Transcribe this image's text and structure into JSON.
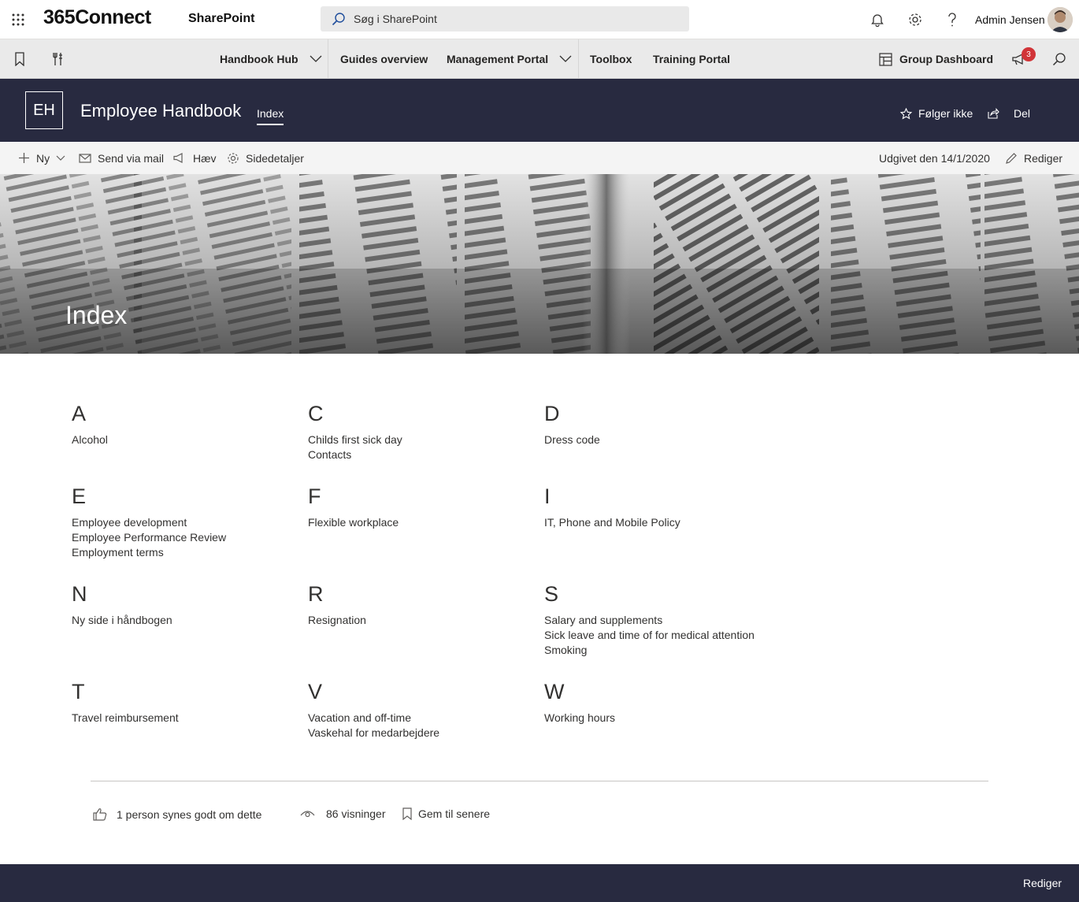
{
  "suitebar": {
    "brand": "365Connect",
    "app_name": "SharePoint",
    "search_placeholder": "Søg i SharePoint",
    "user_name": "Admin Jensen"
  },
  "hubnav": {
    "items": [
      {
        "label": "Handbook Hub",
        "has_dropdown": true
      },
      {
        "label": "Guides overview",
        "has_dropdown": false
      },
      {
        "label": "Management Portal",
        "has_dropdown": true
      },
      {
        "label": "Toolbox",
        "has_dropdown": false
      },
      {
        "label": "Training Portal",
        "has_dropdown": false
      }
    ],
    "group_dashboard": "Group Dashboard",
    "notification_count": "3"
  },
  "site": {
    "logo_text": "EH",
    "title": "Employee Handbook",
    "nav_item": "Index",
    "follow_label": "Følger ikke",
    "share_label": "Del"
  },
  "commandbar": {
    "new_label": "Ny",
    "send_label": "Send via mail",
    "promote_label": "Hæv",
    "details_label": "Sidedetaljer",
    "published": "Udgivet den 14/1/2020",
    "edit_label": "Rediger"
  },
  "banner": {
    "title": "Index"
  },
  "index": [
    {
      "letter": "A",
      "entries": [
        "Alcohol"
      ]
    },
    {
      "letter": "C",
      "entries": [
        "Childs first sick day",
        "Contacts"
      ]
    },
    {
      "letter": "D",
      "entries": [
        "Dress code"
      ]
    },
    {
      "letter": "E",
      "entries": [
        "Employee development",
        "Employee Performance Review",
        "Employment terms"
      ]
    },
    {
      "letter": "F",
      "entries": [
        "Flexible workplace"
      ]
    },
    {
      "letter": "I",
      "entries": [
        "IT, Phone and Mobile Policy"
      ]
    },
    {
      "letter": "N",
      "entries": [
        "Ny side i håndbogen"
      ]
    },
    {
      "letter": "R",
      "entries": [
        "Resignation"
      ]
    },
    {
      "letter": "S",
      "entries": [
        "Salary and supplements",
        "Sick leave and time of for medical attention",
        "Smoking"
      ]
    },
    {
      "letter": "T",
      "entries": [
        "Travel reimbursement"
      ]
    },
    {
      "letter": "V",
      "entries": [
        "Vacation and off-time",
        "Vaskehal for medarbejdere"
      ]
    },
    {
      "letter": "W",
      "entries": [
        "Working hours"
      ]
    }
  ],
  "social": {
    "likes": "1 person synes godt om dette",
    "views": "86 visninger",
    "save": "Gem til senere"
  },
  "footer": {
    "edit_label": "Rediger"
  },
  "colors": {
    "header_bg": "#282a40",
    "hubnav_bg": "#eaeaea",
    "badge": "#d13438"
  }
}
